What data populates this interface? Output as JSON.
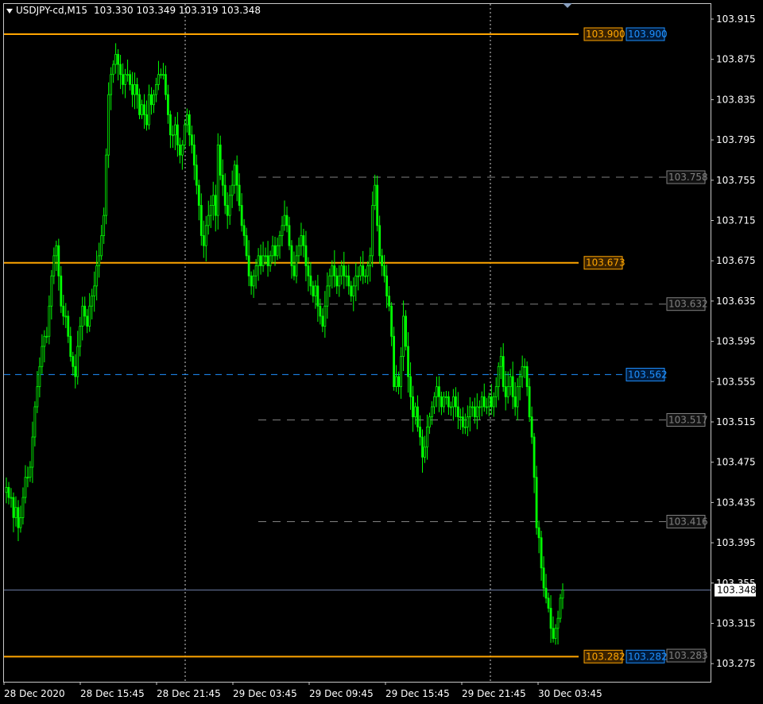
{
  "header": {
    "symbol": "USDJPY-cd,M15",
    "ohlc": "103.330 103.349 103.319 103.348"
  },
  "colors": {
    "background": "#000000",
    "bull_candle": "#00ff00",
    "bear_candle": "#00ff00",
    "orange_line": "#ffa500",
    "blue_line": "#1e90ff",
    "gray_line": "#808080",
    "bid_line": "#6e7fa8",
    "vgrid": "#d0d0d0"
  },
  "chart_data": {
    "type": "candlestick",
    "symbol": "USDJPY-cd",
    "timeframe": "M15",
    "ylim": [
      103.257,
      103.93
    ],
    "y_ticks": [
      "103.915",
      "103.875",
      "103.835",
      "103.795",
      "103.755",
      "103.715",
      "103.675",
      "103.635",
      "103.595",
      "103.555",
      "103.515",
      "103.475",
      "103.435",
      "103.395",
      "103.355",
      "103.315",
      "103.275"
    ],
    "x_ticks": [
      "28 Dec 2020",
      "28 Dec 15:45",
      "28 Dec 21:45",
      "29 Dec 03:45",
      "29 Dec 09:45",
      "29 Dec 15:45",
      "29 Dec 21:45",
      "30 Dec 03:45"
    ],
    "close_series": [
      103.45,
      103.44,
      103.44,
      103.42,
      103.43,
      103.41,
      103.42,
      103.44,
      103.46,
      103.46,
      103.47,
      103.5,
      103.53,
      103.55,
      103.57,
      103.59,
      103.6,
      103.6,
      103.63,
      103.66,
      103.68,
      103.69,
      103.66,
      103.63,
      103.62,
      103.62,
      103.6,
      103.58,
      103.57,
      103.56,
      103.59,
      103.61,
      103.63,
      103.62,
      103.61,
      103.63,
      103.64,
      103.65,
      103.67,
      103.68,
      103.7,
      103.72,
      103.78,
      103.84,
      103.86,
      103.87,
      103.88,
      103.87,
      103.86,
      103.85,
      103.86,
      103.86,
      103.85,
      103.84,
      103.85,
      103.84,
      103.82,
      103.83,
      103.82,
      103.81,
      103.84,
      103.83,
      103.84,
      103.85,
      103.86,
      103.86,
      103.86,
      103.84,
      103.82,
      103.8,
      103.8,
      103.81,
      103.79,
      103.78,
      103.79,
      103.81,
      103.82,
      103.8,
      103.79,
      103.77,
      103.75,
      103.73,
      103.7,
      103.69,
      103.71,
      103.72,
      103.73,
      103.74,
      103.72,
      103.79,
      103.76,
      103.75,
      103.73,
      103.72,
      103.74,
      103.75,
      103.77,
      103.75,
      103.73,
      103.71,
      103.7,
      103.68,
      103.66,
      103.65,
      103.66,
      103.67,
      103.68,
      103.67,
      103.68,
      103.68,
      103.67,
      103.68,
      103.69,
      103.68,
      103.69,
      103.7,
      103.71,
      103.72,
      103.71,
      103.69,
      103.67,
      103.66,
      103.68,
      103.69,
      103.7,
      103.69,
      103.67,
      103.66,
      103.65,
      103.64,
      103.65,
      103.63,
      103.62,
      103.61,
      103.63,
      103.65,
      103.66,
      103.67,
      103.66,
      103.65,
      103.66,
      103.67,
      103.66,
      103.66,
      103.65,
      103.64,
      103.65,
      103.66,
      103.66,
      103.67,
      103.66,
      103.66,
      103.67,
      103.68,
      103.73,
      103.75,
      103.71,
      103.68,
      103.67,
      103.66,
      103.64,
      103.63,
      103.6,
      103.55,
      103.56,
      103.55,
      103.58,
      103.62,
      103.59,
      103.56,
      103.54,
      103.52,
      103.53,
      103.51,
      103.5,
      103.48,
      103.49,
      103.51,
      103.52,
      103.53,
      103.54,
      103.55,
      103.54,
      103.53,
      103.54,
      103.54,
      103.53,
      103.53,
      103.54,
      103.53,
      103.52,
      103.52,
      103.51,
      103.51,
      103.52,
      103.53,
      103.53,
      103.52,
      103.53,
      103.53,
      103.54,
      103.53,
      103.53,
      103.54,
      103.53,
      103.54,
      103.55,
      103.57,
      103.58,
      103.55,
      103.54,
      103.55,
      103.56,
      103.54,
      103.53,
      103.55,
      103.56,
      103.57,
      103.57,
      103.55,
      103.52,
      103.5,
      103.46,
      103.41,
      103.4,
      103.37,
      103.35,
      103.34,
      103.33,
      103.31,
      103.3,
      103.31,
      103.32,
      103.34,
      103.348
    ],
    "horizontal_lines": [
      {
        "label": "103.900",
        "style": "solid",
        "color": "orange",
        "value": 103.9
      },
      {
        "label": "103.673",
        "style": "solid",
        "color": "orange",
        "value": 103.673
      },
      {
        "label": "103.282",
        "style": "solid",
        "color": "orange",
        "value": 103.282
      },
      {
        "label": "103.562",
        "style": "dashed",
        "color": "blue",
        "value": 103.562
      },
      {
        "label": "103.758",
        "style": "dashed",
        "color": "gray",
        "value": 103.758
      },
      {
        "label": "103.632",
        "style": "dashed",
        "color": "gray",
        "value": 103.632
      },
      {
        "label": "103.517",
        "style": "dashed",
        "color": "gray",
        "value": 103.517
      },
      {
        "label": "103.416",
        "style": "dashed",
        "color": "gray",
        "value": 103.416
      }
    ],
    "price_tags": [
      {
        "label": "103.900",
        "color": "orange",
        "value": 103.9
      },
      {
        "label": "103.900",
        "color": "blue",
        "value": 103.9
      },
      {
        "label": "103.673",
        "color": "orange",
        "value": 103.673
      },
      {
        "label": "103.562",
        "color": "blue",
        "value": 103.562
      },
      {
        "label": "103.758",
        "color": "gray",
        "value": 103.758
      },
      {
        "label": "103.632",
        "color": "gray",
        "value": 103.632
      },
      {
        "label": "103.517",
        "color": "gray",
        "value": 103.517
      },
      {
        "label": "103.416",
        "color": "gray",
        "value": 103.416
      },
      {
        "label": "103.282",
        "color": "orange",
        "value": 103.282
      },
      {
        "label": "103.282",
        "color": "blue",
        "value": 103.282
      },
      {
        "label": "103.283",
        "color": "gray",
        "value": 103.283
      }
    ],
    "current_price": {
      "label": "103.348",
      "value": 103.348
    },
    "vertical_separators": [
      "28 Dec 21:45",
      "29 Dec 21:45"
    ]
  }
}
